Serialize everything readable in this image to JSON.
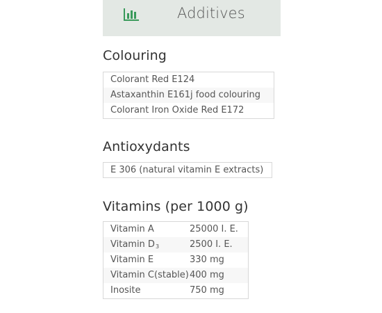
{
  "header": {
    "title": "Additives",
    "icon": "bar-chart-icon",
    "icon_color": "#3a9a5b",
    "background": "#e3e8e4"
  },
  "colouring": {
    "heading": "Colouring",
    "items": [
      "Colorant Red E124",
      "Astaxanthin E161j food colouring",
      "Colorant Iron Oxide Red E172"
    ]
  },
  "antioxydants": {
    "heading": "Antioxydants",
    "items": [
      "E 306 (natural vitamin E extracts)"
    ]
  },
  "vitamins": {
    "heading": "Vitamins (per 1000 g)",
    "rows": [
      {
        "name": "Vitamin A",
        "value": "25000 I. E."
      },
      {
        "name": "Vitamin D",
        "name_subscript": "3",
        "value": "2500 I. E."
      },
      {
        "name": "Vitamin E",
        "value": "330 mg"
      },
      {
        "name": "Vitamin C(stable)",
        "value": "400 mg"
      },
      {
        "name": "Inosite",
        "value": "750 mg"
      }
    ]
  }
}
